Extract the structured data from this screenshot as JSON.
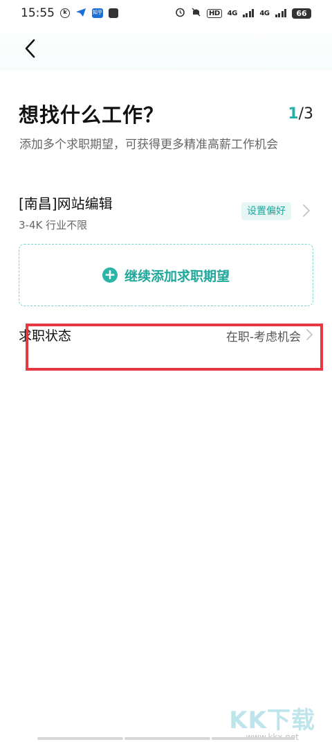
{
  "status_bar": {
    "time": "15:55",
    "left_icons": [
      "k-circle-icon",
      "paper-plane-icon",
      "zhihu-icon",
      "mail-icon"
    ],
    "zhihu_label": "知乎",
    "hd_label": "HD",
    "network_1": "4G",
    "network_2": "4G",
    "battery": "66"
  },
  "nav": {
    "back_icon": "chevron-left-icon"
  },
  "header": {
    "title": "想找什么工作？",
    "step_current": "1",
    "step_total": "/3",
    "subtitle": "添加多个求职期望，可获得更多精准高薪工作机会"
  },
  "preference": {
    "title": "[南昌]网站编辑",
    "detail": "3-4K 行业不限",
    "tag": "设置偏好"
  },
  "add_more": {
    "label": "继续添加求职期望"
  },
  "job_status": {
    "label": "求职状态",
    "value": "在职-考虑机会"
  },
  "watermark": {
    "logo": "KK下载",
    "url": "www.kkx.net"
  },
  "colors": {
    "accent": "#1fb4a8",
    "highlight": "#e8383f",
    "tag_bg": "#e6f6f5"
  }
}
